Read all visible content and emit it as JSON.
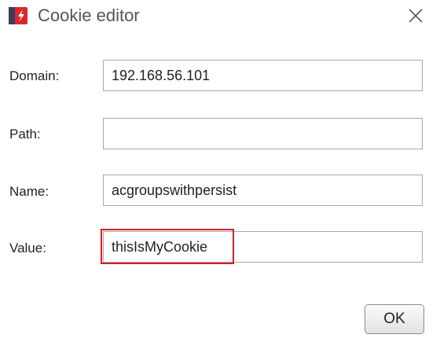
{
  "window": {
    "title": "Cookie editor",
    "icon": "app-logo-icon",
    "close_icon": "close-icon"
  },
  "fields": {
    "domain": {
      "label": "Domain:",
      "value": "192.168.56.101"
    },
    "path": {
      "label": "Path:",
      "value": ""
    },
    "name": {
      "label": "Name:",
      "value": "acgroupswithpersist"
    },
    "value": {
      "label": "Value:",
      "value": "thisIsMyCookie"
    }
  },
  "buttons": {
    "ok_label": "OK"
  },
  "colors": {
    "highlight": "#d01f25",
    "title_text": "#555555"
  }
}
